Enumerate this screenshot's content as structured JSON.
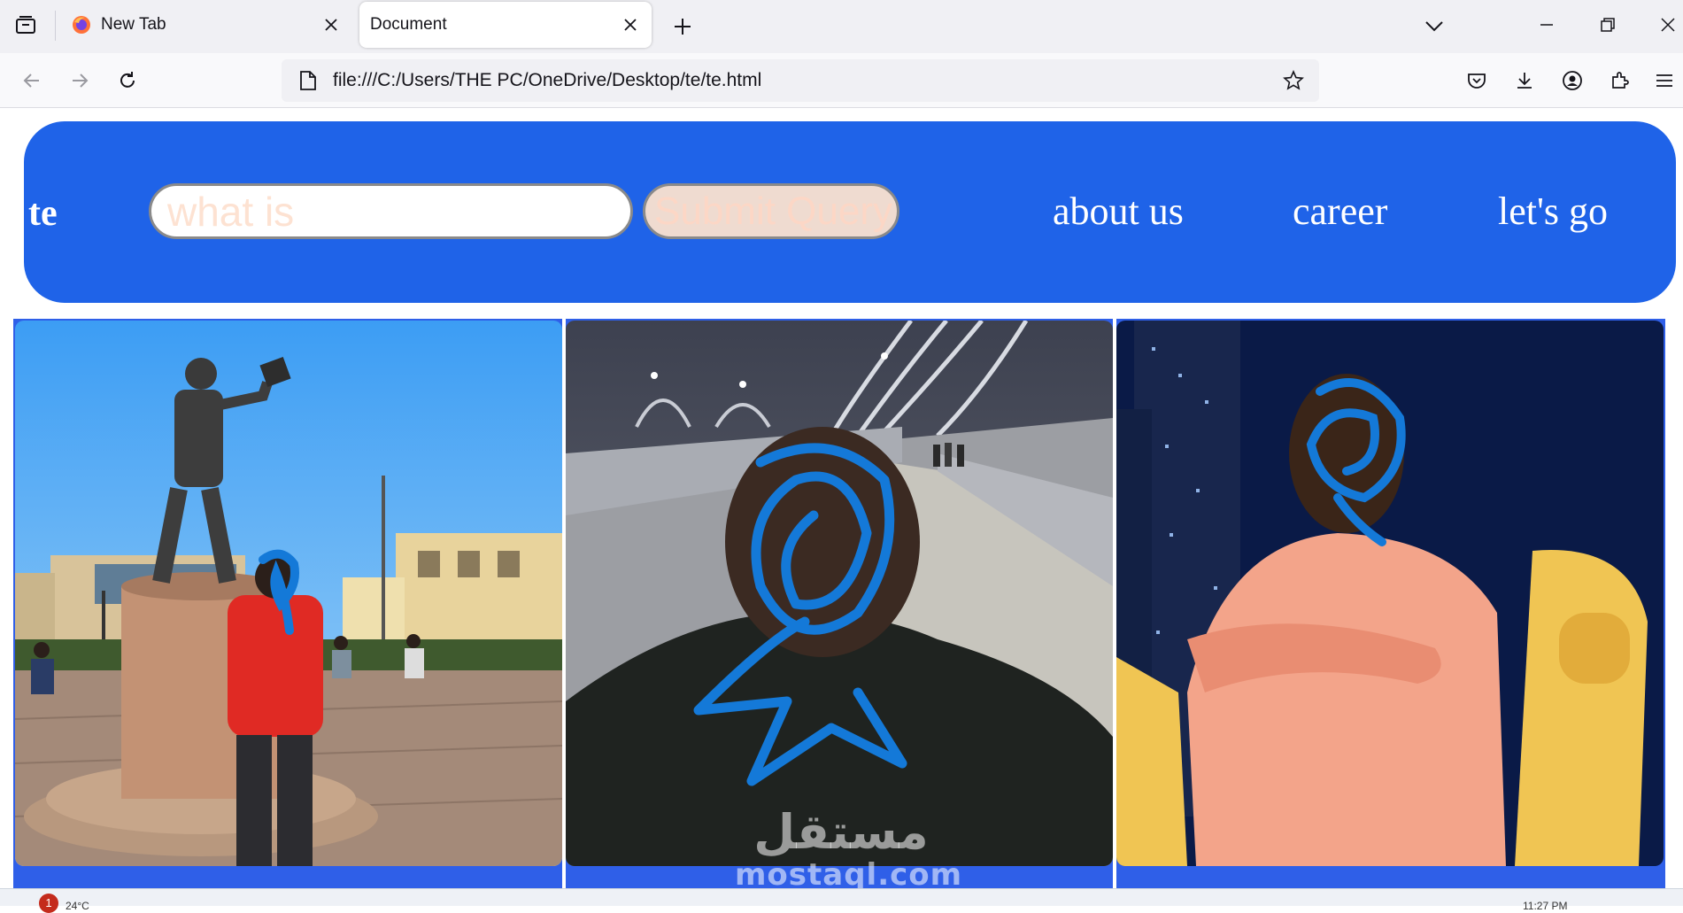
{
  "browser": {
    "tabs": [
      {
        "title": "New Tab",
        "active": false
      },
      {
        "title": "Document",
        "active": true
      }
    ],
    "url": "file:///C:/Users/THE PC/OneDrive/Desktop/te/te.html"
  },
  "page": {
    "logo": "te",
    "search": {
      "placeholder": "what is",
      "value": ""
    },
    "submit_label": "Submit Query",
    "nav_links": [
      "about us",
      "career",
      "let's go"
    ],
    "header_color": "#1f63e8",
    "gallery_color": "#2f5fe8"
  },
  "gallery": [
    {
      "name": "statue-plaza-photo"
    },
    {
      "name": "bridge-night-photo"
    },
    {
      "name": "skyline-portrait-photo"
    }
  ],
  "watermark": {
    "arabic": "مستقل",
    "latin": "mostaql.com"
  },
  "taskbar": {
    "badge": "1",
    "temp": "24°C",
    "time": "11:27 PM"
  }
}
